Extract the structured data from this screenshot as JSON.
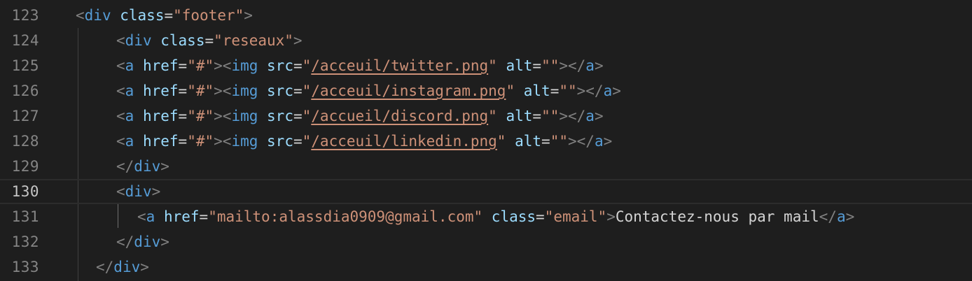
{
  "editor": {
    "theme": {
      "background": "#1e1e1e",
      "line_number": "#858585",
      "tag": "#569cd6",
      "attribute": "#9cdcfe",
      "string": "#ce9178",
      "punctuation": "#808080",
      "text": "#d4d4d4"
    },
    "current_line": "130",
    "lines": [
      {
        "num": "123",
        "tokens": [
          {
            "t": "punct",
            "v": "<"
          },
          {
            "t": "tag",
            "v": "div"
          },
          {
            "t": "text",
            "v": " "
          },
          {
            "t": "attr",
            "v": "class"
          },
          {
            "t": "text",
            "v": "="
          },
          {
            "t": "str",
            "v": "\"footer\""
          },
          {
            "t": "punct",
            "v": ">"
          }
        ]
      },
      {
        "num": "124",
        "tokens": [
          {
            "t": "punct",
            "v": "<"
          },
          {
            "t": "tag",
            "v": "div"
          },
          {
            "t": "text",
            "v": " "
          },
          {
            "t": "attr",
            "v": "class"
          },
          {
            "t": "text",
            "v": "="
          },
          {
            "t": "str",
            "v": "\"reseaux\""
          },
          {
            "t": "punct",
            "v": ">"
          }
        ]
      },
      {
        "num": "125",
        "tokens": [
          {
            "t": "punct",
            "v": "<"
          },
          {
            "t": "tag",
            "v": "a"
          },
          {
            "t": "text",
            "v": " "
          },
          {
            "t": "attr",
            "v": "href"
          },
          {
            "t": "text",
            "v": "="
          },
          {
            "t": "str",
            "v": "\"#\""
          },
          {
            "t": "punct",
            "v": "><"
          },
          {
            "t": "tag",
            "v": "img"
          },
          {
            "t": "text",
            "v": " "
          },
          {
            "t": "attr",
            "v": "src"
          },
          {
            "t": "text",
            "v": "="
          },
          {
            "t": "str",
            "v": "\""
          },
          {
            "t": "link",
            "v": "/acceuil/twitter.png"
          },
          {
            "t": "str",
            "v": "\""
          },
          {
            "t": "text",
            "v": " "
          },
          {
            "t": "attr",
            "v": "alt"
          },
          {
            "t": "text",
            "v": "="
          },
          {
            "t": "str",
            "v": "\"\""
          },
          {
            "t": "punct",
            "v": "></"
          },
          {
            "t": "tag",
            "v": "a"
          },
          {
            "t": "punct",
            "v": ">"
          }
        ]
      },
      {
        "num": "126",
        "tokens": [
          {
            "t": "punct",
            "v": "<"
          },
          {
            "t": "tag",
            "v": "a"
          },
          {
            "t": "text",
            "v": " "
          },
          {
            "t": "attr",
            "v": "href"
          },
          {
            "t": "text",
            "v": "="
          },
          {
            "t": "str",
            "v": "\"#\""
          },
          {
            "t": "punct",
            "v": "><"
          },
          {
            "t": "tag",
            "v": "img"
          },
          {
            "t": "text",
            "v": " "
          },
          {
            "t": "attr",
            "v": "src"
          },
          {
            "t": "text",
            "v": "="
          },
          {
            "t": "str",
            "v": "\""
          },
          {
            "t": "link",
            "v": "/acceuil/instagram.png"
          },
          {
            "t": "str",
            "v": "\""
          },
          {
            "t": "text",
            "v": " "
          },
          {
            "t": "attr",
            "v": "alt"
          },
          {
            "t": "text",
            "v": "="
          },
          {
            "t": "str",
            "v": "\"\""
          },
          {
            "t": "punct",
            "v": "></"
          },
          {
            "t": "tag",
            "v": "a"
          },
          {
            "t": "punct",
            "v": ">"
          }
        ]
      },
      {
        "num": "127",
        "tokens": [
          {
            "t": "punct",
            "v": "<"
          },
          {
            "t": "tag",
            "v": "a"
          },
          {
            "t": "text",
            "v": " "
          },
          {
            "t": "attr",
            "v": "href"
          },
          {
            "t": "text",
            "v": "="
          },
          {
            "t": "str",
            "v": "\"#\""
          },
          {
            "t": "punct",
            "v": "><"
          },
          {
            "t": "tag",
            "v": "img"
          },
          {
            "t": "text",
            "v": " "
          },
          {
            "t": "attr",
            "v": "src"
          },
          {
            "t": "text",
            "v": "="
          },
          {
            "t": "str",
            "v": "\""
          },
          {
            "t": "link",
            "v": "/accueil/discord.png"
          },
          {
            "t": "str",
            "v": "\""
          },
          {
            "t": "text",
            "v": " "
          },
          {
            "t": "attr",
            "v": "alt"
          },
          {
            "t": "text",
            "v": "="
          },
          {
            "t": "str",
            "v": "\"\""
          },
          {
            "t": "punct",
            "v": "></"
          },
          {
            "t": "tag",
            "v": "a"
          },
          {
            "t": "punct",
            "v": ">"
          }
        ]
      },
      {
        "num": "128",
        "tokens": [
          {
            "t": "punct",
            "v": "<"
          },
          {
            "t": "tag",
            "v": "a"
          },
          {
            "t": "text",
            "v": " "
          },
          {
            "t": "attr",
            "v": "href"
          },
          {
            "t": "text",
            "v": "="
          },
          {
            "t": "str",
            "v": "\"#\""
          },
          {
            "t": "punct",
            "v": "><"
          },
          {
            "t": "tag",
            "v": "img"
          },
          {
            "t": "text",
            "v": " "
          },
          {
            "t": "attr",
            "v": "src"
          },
          {
            "t": "text",
            "v": "="
          },
          {
            "t": "str",
            "v": "\""
          },
          {
            "t": "link",
            "v": "/acceuil/linkedin.png"
          },
          {
            "t": "str",
            "v": "\""
          },
          {
            "t": "text",
            "v": " "
          },
          {
            "t": "attr",
            "v": "alt"
          },
          {
            "t": "text",
            "v": "="
          },
          {
            "t": "str",
            "v": "\"\""
          },
          {
            "t": "punct",
            "v": "></"
          },
          {
            "t": "tag",
            "v": "a"
          },
          {
            "t": "punct",
            "v": ">"
          }
        ]
      },
      {
        "num": "129",
        "tokens": [
          {
            "t": "punct",
            "v": "</"
          },
          {
            "t": "tag",
            "v": "div"
          },
          {
            "t": "punct",
            "v": ">"
          }
        ]
      },
      {
        "num": "130",
        "tokens": [
          {
            "t": "punct",
            "v": "<"
          },
          {
            "t": "tag",
            "v": "div"
          },
          {
            "t": "punct",
            "v": ">"
          }
        ]
      },
      {
        "num": "131",
        "tokens": [
          {
            "t": "punct",
            "v": "<"
          },
          {
            "t": "tag",
            "v": "a"
          },
          {
            "t": "text",
            "v": " "
          },
          {
            "t": "attr",
            "v": "href"
          },
          {
            "t": "text",
            "v": "="
          },
          {
            "t": "str",
            "v": "\"mailto:alassdia0909@gmail.com\""
          },
          {
            "t": "text",
            "v": " "
          },
          {
            "t": "attr",
            "v": "class"
          },
          {
            "t": "text",
            "v": "="
          },
          {
            "t": "str",
            "v": "\"email\""
          },
          {
            "t": "punct",
            "v": ">"
          },
          {
            "t": "text",
            "v": "Contactez-nous par mail"
          },
          {
            "t": "punct",
            "v": "</"
          },
          {
            "t": "tag",
            "v": "a"
          },
          {
            "t": "punct",
            "v": ">"
          }
        ]
      },
      {
        "num": "132",
        "tokens": [
          {
            "t": "punct",
            "v": "</"
          },
          {
            "t": "tag",
            "v": "div"
          },
          {
            "t": "punct",
            "v": ">"
          }
        ]
      },
      {
        "num": "133",
        "tokens": [
          {
            "t": "punct",
            "v": "</"
          },
          {
            "t": "tag",
            "v": "div"
          },
          {
            "t": "punct",
            "v": ">"
          }
        ]
      }
    ]
  }
}
